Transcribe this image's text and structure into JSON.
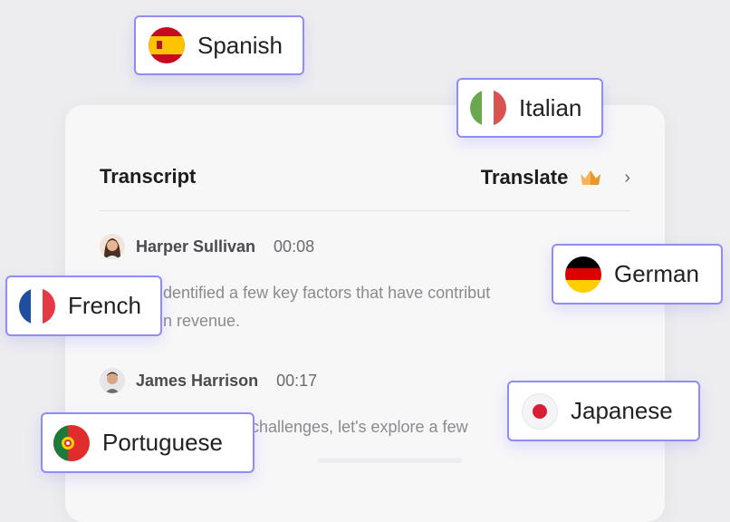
{
  "card": {
    "title": "Transcript",
    "translate_label": "Translate"
  },
  "entries": [
    {
      "speaker": "Harper Sullivan",
      "time": "00:08",
      "text": "identified a few key factors that have contribut",
      "text2": "in revenue."
    },
    {
      "speaker": "James Harrison",
      "time": "00:17",
      "text": "challenges, let's explore a few"
    }
  ],
  "languages": {
    "spanish": "Spanish",
    "italian": "Italian",
    "german": "German",
    "french": "French",
    "japanese": "Japanese",
    "portuguese": "Portuguese"
  },
  "colors": {
    "chip_border": "#8f8cf5",
    "card_bg": "#f7f7f8",
    "page_bg": "#ededf0",
    "crown": "#f0a33a"
  }
}
